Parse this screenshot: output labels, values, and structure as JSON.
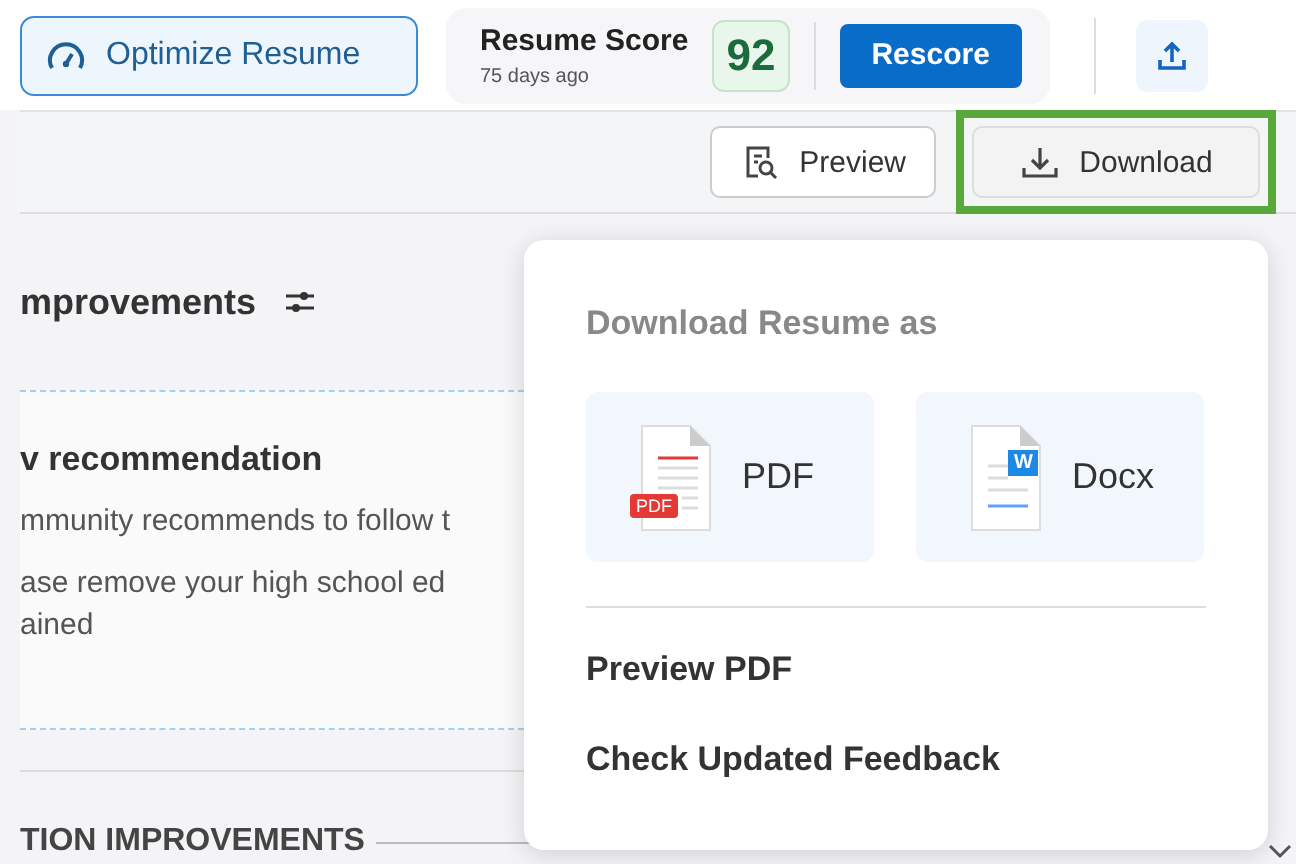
{
  "header": {
    "optimize_button": "Optimize Resume",
    "score_label": "Resume Score",
    "score_age": "75 days ago",
    "score": "92",
    "rescore_button": "Rescore"
  },
  "toolbar": {
    "preview_button": "Preview",
    "download_button": "Download",
    "download_highlighted": true
  },
  "panel": {
    "heading": "mprovements",
    "card_title": "v recommendation",
    "card_lines": [
      "mmunity recommends to follow t",
      "ase remove your high school ed",
      "ained"
    ],
    "section_heading": "TION IMPROVEMENTS"
  },
  "download_menu": {
    "title": "Download Resume as",
    "options": [
      {
        "kind": "pdf",
        "label": "PDF",
        "badge": "PDF"
      },
      {
        "kind": "docx",
        "label": "Docx",
        "badge": "W"
      }
    ],
    "items": [
      "Preview PDF",
      "Check Updated Feedback"
    ]
  }
}
